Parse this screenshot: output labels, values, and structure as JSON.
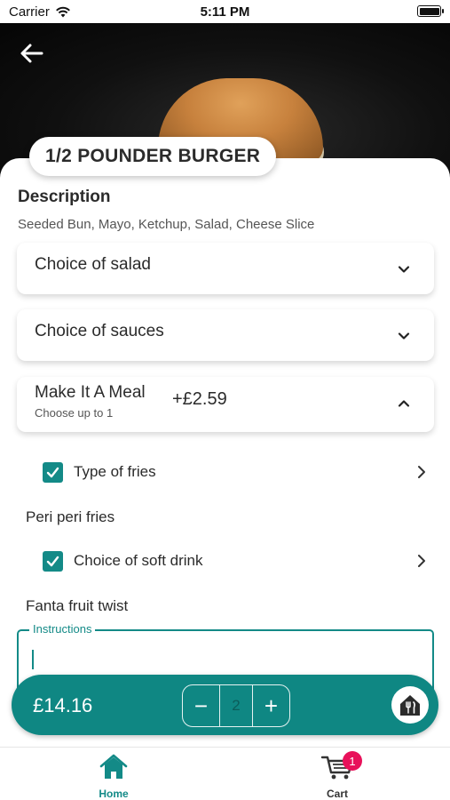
{
  "status_bar": {
    "carrier": "Carrier",
    "time": "5:11 PM"
  },
  "product": {
    "title": "1/2 POUNDER BURGER",
    "description_heading": "Description",
    "description": "Seeded Bun, Mayo, Ketchup, Salad, Cheese Slice"
  },
  "options": {
    "salad_label": "Choice of salad",
    "sauces_label": "Choice of sauces",
    "meal": {
      "label": "Make It A Meal",
      "sub": "Choose up to 1",
      "price": "+£2.59",
      "items": [
        {
          "label": "Type of fries",
          "checked": true,
          "selected": "Peri peri fries"
        },
        {
          "label": "Choice of soft drink",
          "checked": true,
          "selected": "Fanta fruit twist"
        }
      ]
    }
  },
  "instructions": {
    "label": "Instructions",
    "value": ""
  },
  "order": {
    "total": "£14.16",
    "quantity": "2",
    "minus": "−",
    "plus": "+"
  },
  "tabs": [
    {
      "label": "Home",
      "icon": "home-icon",
      "active": true
    },
    {
      "label": "Cart",
      "icon": "cart-icon",
      "badge": "1"
    }
  ],
  "colors": {
    "accent": "#138a87",
    "bar": "#0f8783",
    "badge": "#e8115a"
  }
}
